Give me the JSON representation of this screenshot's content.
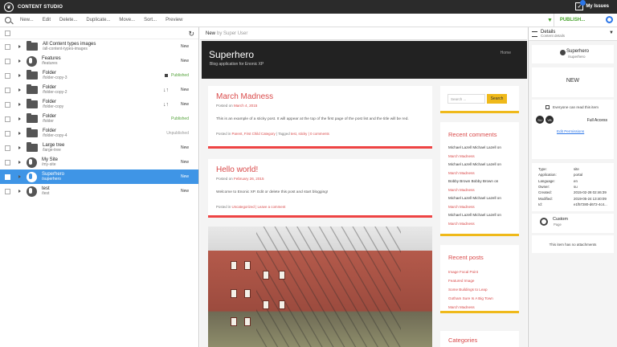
{
  "app": {
    "title": "CONTENT STUDIO",
    "issues_label": "My Issues"
  },
  "toolbar": {
    "new_label": "New...",
    "edit_label": "Edit",
    "delete_label": "Delete...",
    "duplicate_label": "Duplicate...",
    "move_label": "Move...",
    "sort_label": "Sort...",
    "preview_label": "Preview",
    "publish_label": "PUBLISH..."
  },
  "colors": {
    "accent_blue": "#3f95e6",
    "publish_green": "#47a32c",
    "post_red": "#d94a4a",
    "sidebar_yellow": "#efb91a"
  },
  "list": {
    "items": [
      {
        "icon": "folder-icon",
        "title": "All Content types images",
        "path": "/all-content-types-images",
        "status": "New",
        "status_type": "new",
        "marker": ""
      },
      {
        "icon": "globe-icon",
        "title": "Features",
        "path": "/features",
        "status": "New",
        "status_type": "new",
        "marker": ""
      },
      {
        "icon": "folder-icon",
        "title": "Folder",
        "path": "/folder-copy-3",
        "status": "Published",
        "status_type": "published",
        "marker": "square"
      },
      {
        "icon": "folder-icon",
        "title": "Folder",
        "path": "/folder-copy-2",
        "status": "New",
        "status_type": "new",
        "marker": "sort"
      },
      {
        "icon": "folder-icon",
        "title": "Folder",
        "path": "/folder-copy",
        "status": "New",
        "status_type": "new",
        "marker": "sort"
      },
      {
        "icon": "folder-icon",
        "title": "Folder",
        "path": "/folder",
        "status": "Published",
        "status_type": "published",
        "marker": ""
      },
      {
        "icon": "folder-icon",
        "title": "Folder",
        "path": "/folder-copy-4",
        "status": "Unpublished",
        "status_type": "unpub",
        "marker": ""
      },
      {
        "icon": "folder-icon",
        "title": "Large tree",
        "path": "/large-tree",
        "status": "New",
        "status_type": "new",
        "marker": ""
      },
      {
        "icon": "globe-icon",
        "title": "My Site",
        "path": "/my-site",
        "status": "New",
        "status_type": "new",
        "marker": ""
      },
      {
        "icon": "globe-icon",
        "title": "Superhero",
        "path": "/superhero",
        "status": "New",
        "status_type": "new",
        "marker": "",
        "selected": true
      },
      {
        "icon": "globe-icon",
        "title": "test",
        "path": "/test",
        "status": "New",
        "status_type": "new",
        "marker": ""
      }
    ]
  },
  "preview": {
    "status": "New",
    "by": "by Super User",
    "site_title": "Superhero",
    "site_subtitle": "Blog application for Enonic XP",
    "home_link": "Home",
    "posts": [
      {
        "title": "March Madness",
        "date_prefix": "Posted on",
        "date": "March 4, 2015",
        "body": "This is an example of a sticky post. It will appear at the top of the first page of the post list and the title will be red.",
        "footer_prefix": "Posted in",
        "footer_links": "Parent, First Child Category",
        "footer_tags_prefix": "| Tagged",
        "footer_tags": "test, sticky",
        "footer_comments": "| 0 comments"
      },
      {
        "title": "Hello world!",
        "date_prefix": "Posted on",
        "date": "February 26, 2015",
        "body": "Welcome to Enonic XP. Edit or delete this post and start blogging!",
        "footer_prefix": "Posted in",
        "footer_links": "Uncategorized",
        "footer_comments": "| Leave a comment"
      }
    ],
    "sidebar": {
      "search_placeholder": "Search ...",
      "search_button": "Search",
      "recent_comments_title": "Recent comments",
      "comments": [
        "Michael Lazell Michael Lazell on",
        "March Madness",
        "Michael Lazell Michael Lazell on",
        "March Madness",
        "Bobby Brown Bobby Brown on",
        "March Madness",
        "Michael Lazell Michael Lazell on",
        "March Madness",
        "Michael Lazell Michael Lazell on",
        "March Madness"
      ],
      "recent_posts_title": "Recent posts",
      "recent_posts": [
        "Image Focal Point",
        "Featured Image",
        "Some Buildings to Leap",
        "Gotham Sure Is A Big Town",
        "March Madness"
      ],
      "categories_title": "Categories"
    }
  },
  "details": {
    "title": "Details",
    "subtitle": "Content details",
    "name": "Superhero",
    "path": "/superhero",
    "status": "NEW",
    "everyone_access": "Everyone can read this item",
    "avatars": [
      "SU",
      "VB"
    ],
    "full_access": "Full Access",
    "edit_permissions": "Edit Permissions",
    "meta": [
      {
        "label": "Type:",
        "value": "site"
      },
      {
        "label": "Application:",
        "value": "portal"
      },
      {
        "label": "Language:",
        "value": "en"
      },
      {
        "label": "Owner:",
        "value": "su"
      },
      {
        "label": "Created:",
        "value": "2015-02-28 02:46:39"
      },
      {
        "label": "Modified:",
        "value": "2019-05-24 13:40:09"
      },
      {
        "label": "Id:",
        "value": "e1f57280-d672-4c4..."
      }
    ],
    "custom_title": "Custom",
    "custom_subtitle": "Page",
    "attachments": "This item has no attachments"
  }
}
